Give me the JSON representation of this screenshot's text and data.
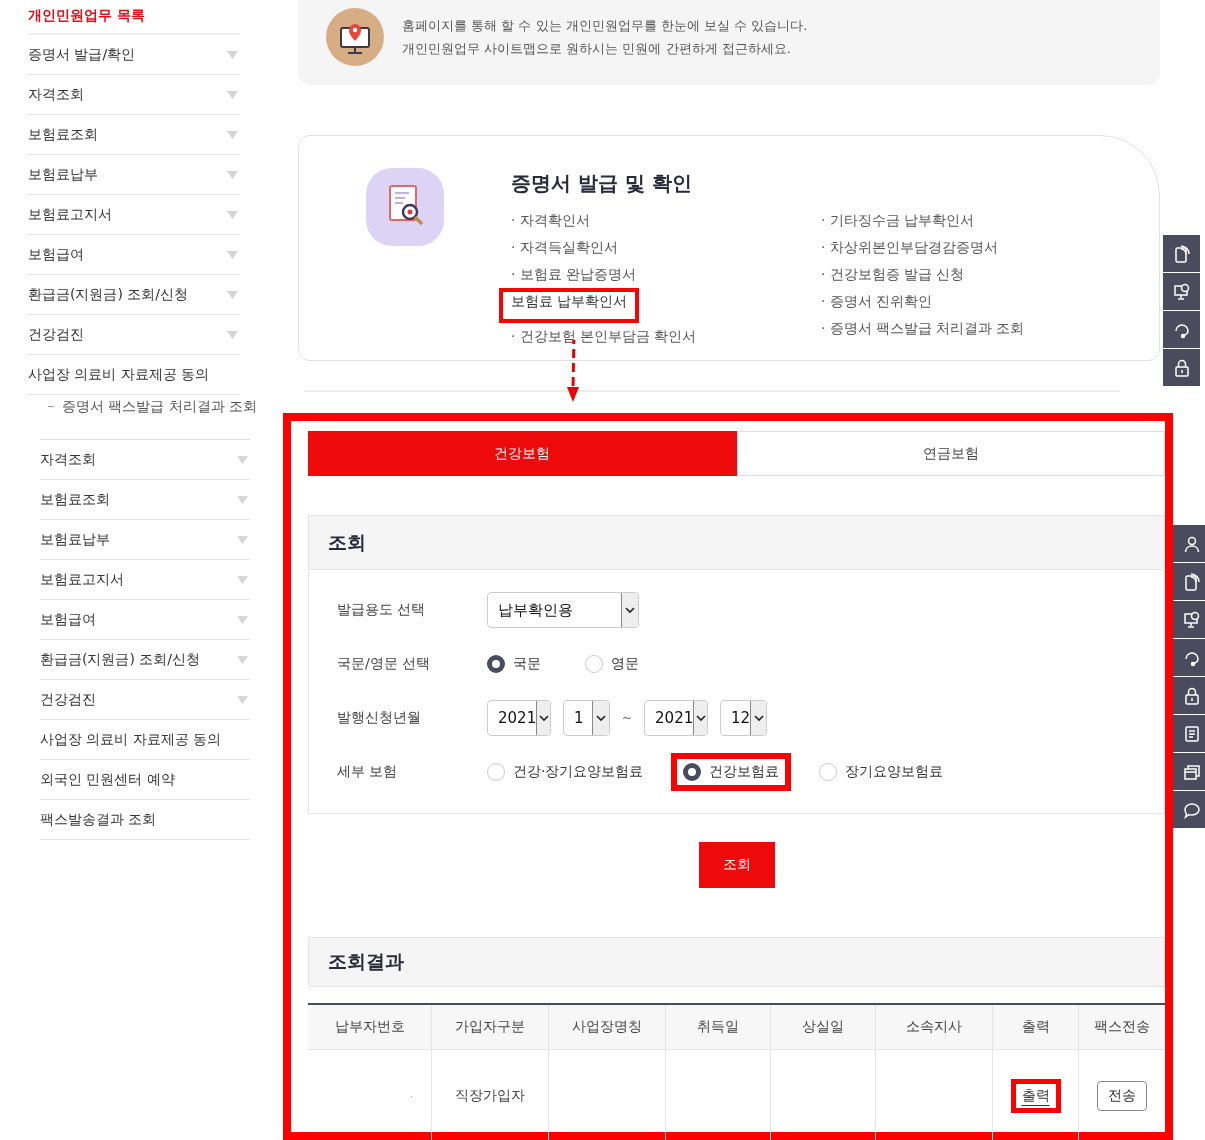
{
  "sidebar": {
    "title": "개인민원업무 목록",
    "items": [
      {
        "label": "증명서 발급/확인",
        "collapsible": true
      },
      {
        "label": "자격조회",
        "collapsible": true
      },
      {
        "label": "보험료조회",
        "collapsible": true
      },
      {
        "label": "보험료납부",
        "collapsible": true
      },
      {
        "label": "보험료고지서",
        "collapsible": true
      },
      {
        "label": "보험급여",
        "collapsible": true
      },
      {
        "label": "환급금(지원금) 조회/신청",
        "collapsible": true
      },
      {
        "label": "건강검진",
        "collapsible": true
      },
      {
        "label": "사업장 의료비 자료제공 동의",
        "collapsible": false
      }
    ]
  },
  "sidebar_lower": {
    "cut_item": "증명서 팩스발급 처리결과 조회",
    "items": [
      {
        "label": "자격조회",
        "collapsible": true
      },
      {
        "label": "보험료조회",
        "collapsible": true
      },
      {
        "label": "보험료납부",
        "collapsible": true
      },
      {
        "label": "보험료고지서",
        "collapsible": true
      },
      {
        "label": "보험급여",
        "collapsible": true
      },
      {
        "label": "환급금(지원금) 조회/신청",
        "collapsible": true
      },
      {
        "label": "건강검진",
        "collapsible": true
      },
      {
        "label": "사업장 의료비 자료제공 동의",
        "collapsible": false
      },
      {
        "label": "외국인 민원센터 예약",
        "collapsible": false
      },
      {
        "label": "팩스발송결과 조회",
        "collapsible": false
      }
    ]
  },
  "intro": {
    "lines": [
      "홈페이지를 통해 할 수 있는 개인민원업무를 한눈에 보실 수 있습니다.",
      "개인민원업무 사이트맵으로 원하시는 민원에 간편하게 접근하세요."
    ]
  },
  "certificates": {
    "title": "증명서 발급 및 확인",
    "items": [
      {
        "label": "· 자격확인서",
        "highlighted": false
      },
      {
        "label": "· 자격득실확인서",
        "highlighted": false
      },
      {
        "label": "· 보험료 완납증명서",
        "highlighted": false
      },
      {
        "label": "보험료 납부확인서",
        "highlighted": true
      },
      {
        "label": "· 건강보험 본인부담금 확인서",
        "highlighted": false
      },
      {
        "label": "· 기타징수금 납부확인서",
        "highlighted": false
      },
      {
        "label": "· 차상위본인부담경감증명서",
        "highlighted": false
      },
      {
        "label": "· 건강보험증 발급 신청",
        "highlighted": false
      },
      {
        "label": "· 증명서 진위확인",
        "highlighted": false
      },
      {
        "label": "· 증명서 팩스발급 처리결과 조회",
        "highlighted": false
      }
    ]
  },
  "toolbar_top": [
    {
      "kind": "phone"
    },
    {
      "kind": "monitor"
    },
    {
      "kind": "headset"
    },
    {
      "kind": "lock"
    }
  ],
  "toolbar_side": [
    {
      "kind": "person"
    },
    {
      "kind": "phone"
    },
    {
      "kind": "monitor"
    },
    {
      "kind": "headset"
    },
    {
      "kind": "lock"
    },
    {
      "kind": "document"
    },
    {
      "kind": "windows"
    },
    {
      "kind": "chat"
    }
  ],
  "tabs": [
    {
      "label": "건강보험",
      "selected": true
    },
    {
      "label": "연금보험",
      "selected": false
    }
  ],
  "search": {
    "title": "조회",
    "purpose": {
      "label": "발급용도 선택",
      "value": "납부확인용"
    },
    "language": {
      "label": "국문/영문 선택",
      "options": [
        {
          "label": "국문",
          "selected": true,
          "highlighted": false
        },
        {
          "label": "영문",
          "selected": false,
          "highlighted": false
        }
      ]
    },
    "period": {
      "label": "발행신청년월",
      "from_year": "2021",
      "from_month": "1",
      "separator": "~",
      "to_year": "2021",
      "to_month": "12"
    },
    "detail": {
      "label": "세부 보험",
      "options": [
        {
          "label": "건강·장기요양보험료",
          "selected": false,
          "highlighted": false
        },
        {
          "label": "건강보험료",
          "selected": true,
          "highlighted": true
        },
        {
          "label": "장기요양보험료",
          "selected": false,
          "highlighted": false
        }
      ]
    },
    "button": "조회"
  },
  "results": {
    "title": "조회결과",
    "columns": [
      "납부자번호",
      "가입자구분",
      "사업장명칭",
      "취득일",
      "상실일",
      "소속지사",
      "출력",
      "팩스전송"
    ],
    "rows": [
      {
        "member_type": "직장가입자",
        "print": "출력",
        "print_highlighted": true,
        "fax": "전송"
      }
    ]
  }
}
